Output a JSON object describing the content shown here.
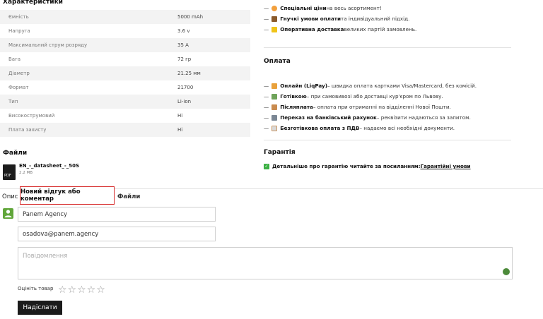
{
  "specs": {
    "title": "Характеристики",
    "rows": [
      {
        "k": "Ємність",
        "v": "5000 mAh"
      },
      {
        "k": "Напруга",
        "v": "3.6 v"
      },
      {
        "k": "Максимальний струм розряду",
        "v": "35 A"
      },
      {
        "k": "Вага",
        "v": "72 гр"
      },
      {
        "k": "Діаметр",
        "v": "21.25 мм"
      },
      {
        "k": "Формат",
        "v": "21700"
      },
      {
        "k": "Тип",
        "v": "Li-ion"
      },
      {
        "k": "Високострумовий",
        "v": "Hi"
      },
      {
        "k": "Плата захисту",
        "v": "Hi"
      }
    ]
  },
  "files": {
    "title": "Файли",
    "name": "EN_-_datasheet_-_50S",
    "size": "2.2 MB",
    "type": "PDF"
  },
  "perks": [
    {
      "b": "Спеціальні ціни",
      "t": " на весь асортимент!"
    },
    {
      "b": "Гнучкі умови оплати",
      "t": " та індивідуальний підхід."
    },
    {
      "b": "Оперативна доставка",
      "t": " великих партій замовлень."
    }
  ],
  "payment": {
    "title": "Оплата",
    "items": [
      {
        "b": "Онлайн (LiqPay)",
        "t": " – швидка оплата картками Visa/Mastercard, без комісій."
      },
      {
        "b": "Готівкою",
        "t": " – при самовивозі або доставці кур'єром по Львову."
      },
      {
        "b": "Післяплата",
        "t": " – оплата при отриманні на відділенні Нової Пошти."
      },
      {
        "b": "Переказ на банківський рахунок",
        "t": " – реквізити надаються за запитом."
      },
      {
        "b": "Безготівкова оплата з ПДВ",
        "t": " – надаємо всі необхідні документи."
      }
    ]
  },
  "warranty": {
    "title": "Гарантія",
    "text": "Детальніше про гарантію читайте за посиланням: ",
    "link": "Гарантійні умови"
  },
  "tabs": {
    "desc": "Опис",
    "review": "Новий відгук або коментар",
    "files": "Файли"
  },
  "form": {
    "name": "Panem Agency",
    "email": "osadova@panem.agency",
    "message_placeholder": "Повідомлення",
    "rating_label": "Оцініть товар",
    "stars": "☆☆☆☆☆",
    "submit": "Надіслати"
  },
  "colors": {
    "accent_red": "#d62828",
    "avatar_green": "#61a63a"
  }
}
